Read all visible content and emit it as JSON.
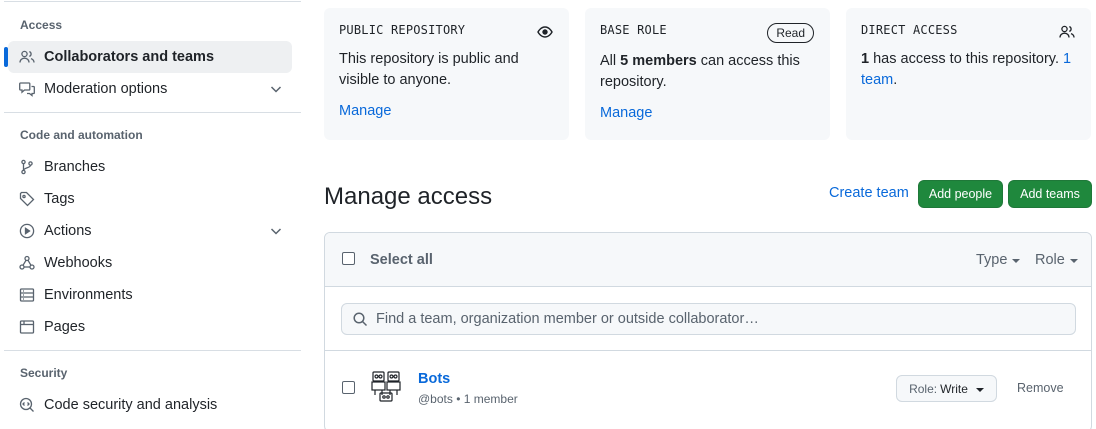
{
  "sidebar": {
    "sections": [
      {
        "heading": "Access"
      },
      {
        "heading": "Code and automation"
      },
      {
        "heading": "Security"
      }
    ],
    "items": [
      {
        "label": "Collaborators and teams",
        "icon": "people-icon",
        "active": true
      },
      {
        "label": "Moderation options",
        "icon": "comment-discussion-icon"
      },
      {
        "label": "Branches",
        "icon": "git-branch-icon"
      },
      {
        "label": "Tags",
        "icon": "tag-icon"
      },
      {
        "label": "Actions",
        "icon": "play-icon"
      },
      {
        "label": "Webhooks",
        "icon": "webhook-icon"
      },
      {
        "label": "Environments",
        "icon": "server-icon"
      },
      {
        "label": "Pages",
        "icon": "browser-icon"
      },
      {
        "label": "Code security and analysis",
        "icon": "codescan-icon"
      }
    ]
  },
  "cards": {
    "public": {
      "title": "PUBLIC REPOSITORY",
      "text": "This repository is public and visible to anyone.",
      "manage": "Manage",
      "icon": "eye-icon"
    },
    "base_role": {
      "title": "BASE ROLE",
      "badge": "Read",
      "text_prefix": "All",
      "text_bold": "5 members",
      "text_suffix": "can access this repository.",
      "manage": "Manage"
    },
    "direct": {
      "title": "DIRECT ACCESS",
      "count": "1",
      "text": "has access to this repository.",
      "link": "1 team",
      "period": ".",
      "icon": "people-icon"
    }
  },
  "manage": {
    "title": "Manage access",
    "create_team": "Create team",
    "add_people": "Add people",
    "add_teams": "Add teams"
  },
  "table": {
    "select_all": "Select all",
    "filter_type": "Type",
    "filter_role": "Role",
    "search_placeholder": "Find a team, organization member or outside collaborator…",
    "rows": [
      {
        "name": "Bots",
        "meta": "@bots • 1 member",
        "role_key": "Role:",
        "role_value": "Write",
        "remove": "Remove"
      }
    ]
  },
  "colors": {
    "accent": "#0969da",
    "primary_button": "#1f883d",
    "card_bg": "#f6f8fa",
    "border": "#d1d9e0"
  }
}
